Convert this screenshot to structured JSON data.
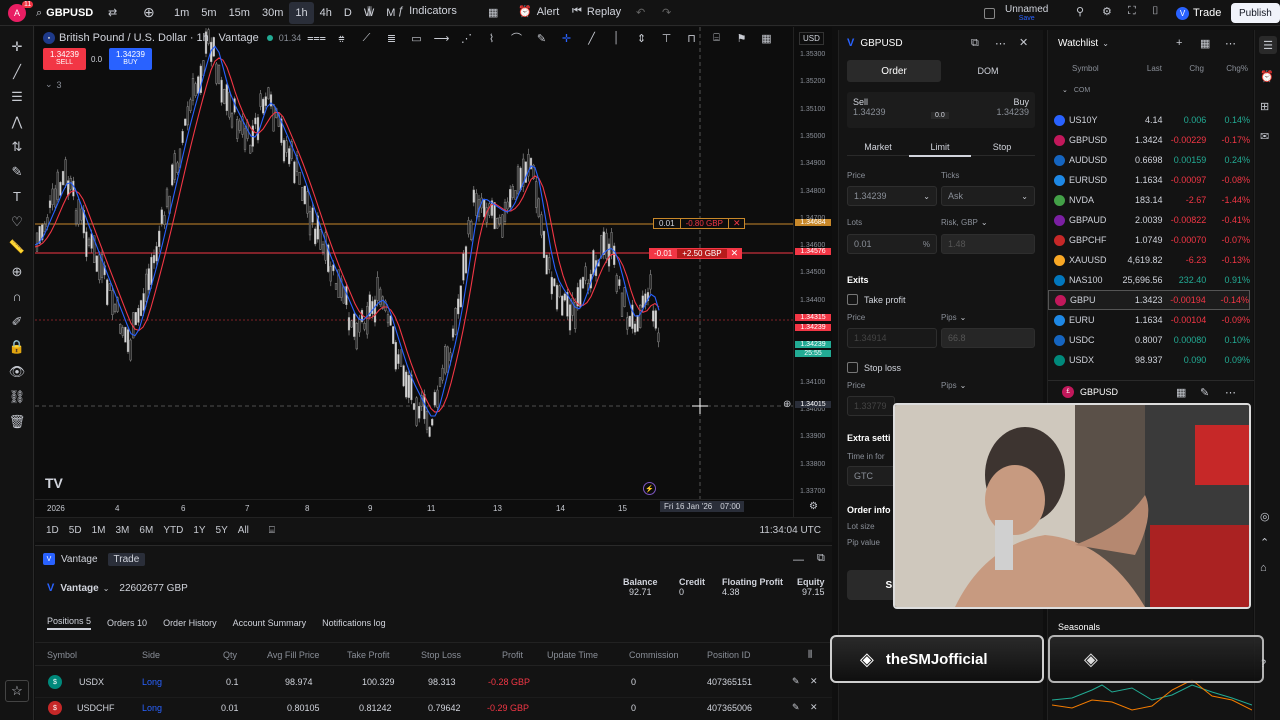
{
  "topbar": {
    "symbol": "GBPUSD",
    "timeframes": [
      "1m",
      "5m",
      "15m",
      "30m",
      "1h",
      "4h",
      "D",
      "W",
      "M"
    ],
    "active_timeframe": "1h",
    "indicators_label": "Indicators",
    "alert_label": "Alert",
    "replay_label": "Replay",
    "layout_name": "Unnamed",
    "layout_sub": "Save",
    "trade_label": "Trade",
    "publish_label": "Publish",
    "avatar_badge": "11"
  },
  "chart": {
    "legend_title": "British Pound / U.S. Dollar · 1h · Vantage",
    "legend_price": "01.34",
    "sell_price": "1.34239",
    "sell_label": "SELL",
    "spread": "0.0",
    "buy_price": "1.34239",
    "buy_label": "BUY",
    "indicator_count": "3",
    "currency": "USD",
    "order_line_1": {
      "qty": "0.01",
      "pnl": "-0.80 GBP"
    },
    "order_line_2": {
      "qty": "-0.01",
      "pnl": "+2.50 GBP"
    },
    "price_ticks": [
      "1.35300",
      "1.35200",
      "1.35100",
      "1.35000",
      "1.34900",
      "1.34800",
      "1.34700",
      "1.34600",
      "1.34500",
      "1.34400",
      "1.34300",
      "1.34200",
      "1.34100",
      "1.34000",
      "1.33900",
      "1.33800",
      "1.33700"
    ],
    "tag_upper": "1.34684",
    "tag_lower": "1.34576",
    "tag_price_a": "1.34315",
    "tag_price_b": "1.34239",
    "tag_price_c": "1.34239",
    "tag_time": "25:55",
    "crosshair_price": "1.34015",
    "date_ticks": [
      "2026",
      "4",
      "6",
      "7",
      "8",
      "9",
      "11",
      "13",
      "14",
      "15"
    ],
    "crosshair_date": "Fri 16 Jan '26",
    "crosshair_time": "07:00"
  },
  "rangebar": {
    "ranges": [
      "1D",
      "5D",
      "1M",
      "3M",
      "6M",
      "YTD",
      "1Y",
      "5Y",
      "All"
    ],
    "clock": "11:34:04 UTC"
  },
  "bottom": {
    "broker": "Vantage",
    "trade_tab": "Trade",
    "account": "22602677 GBP",
    "balance_label": "Balance",
    "balance": "92.71",
    "credit_label": "Credit",
    "credit": "0",
    "floating_label": "Floating Profit",
    "floating": "4.38",
    "equity_label": "Equity",
    "equity": "97.15",
    "tabs": [
      "Positions 5",
      "Orders 10",
      "Order History",
      "Account Summary",
      "Notifications log"
    ],
    "columns": [
      "Symbol",
      "Side",
      "Qty",
      "Avg Fill Price",
      "Take Profit",
      "Stop Loss",
      "Profit",
      "Update Time",
      "Commission",
      "Position ID"
    ],
    "rows": [
      {
        "symbol": "USDX",
        "side": "Long",
        "qty": "0.1",
        "avg": "98.974",
        "tp": "100.329",
        "sl": "98.313",
        "profit": "-0.28 GBP",
        "update": "",
        "commission": "0",
        "id": "407365151"
      },
      {
        "symbol": "USDCHF",
        "side": "Long",
        "qty": "0.01",
        "avg": "0.80105",
        "tp": "0.81242",
        "sl": "0.79642",
        "profit": "-0.29 GBP",
        "update": "",
        "commission": "0",
        "id": "407365006"
      }
    ]
  },
  "order": {
    "symbol": "GBPUSD",
    "tab_order": "Order",
    "tab_dom": "DOM",
    "sell_label": "Sell",
    "sell_price": "1.34239",
    "spread": "0.0",
    "buy_label": "Buy",
    "buy_price": "1.34239",
    "types": [
      "Market",
      "Limit",
      "Stop"
    ],
    "active_type": "Limit",
    "price_label": "Price",
    "price_value": "1.34239",
    "ticks_label": "Ticks",
    "ticks_value": "Ask",
    "lots_label": "Lots",
    "lots_value": "0.01",
    "risk_label": "Risk, GBP",
    "risk_value": "1.48",
    "exits_label": "Exits",
    "take_profit_label": "Take profit",
    "tp_price_label": "Price",
    "tp_price_value": "1.34914",
    "tp_pips_label": "Pips",
    "tp_pips_value": "66.8",
    "stop_loss_label": "Stop loss",
    "sl_price_label": "Price",
    "sl_price_value": "1.33779",
    "sl_pips_label": "Pips",
    "extra_label": "Extra setti",
    "time_in_force_label": "Time in for",
    "tif_value": "GTC",
    "order_info_label": "Order info",
    "lot_size_label": "Lot size",
    "pip_value_label": "Pip value",
    "submit_label": "Si"
  },
  "watchlist": {
    "title": "Watchlist",
    "headers": [
      "Symbol",
      "Last",
      "Chg",
      "Chg%"
    ],
    "group": "COM",
    "items": [
      {
        "symbol": "US10Y",
        "last": "4.14",
        "chg": "0.006",
        "pct": "0.14%",
        "up": true,
        "color": "#2962ff"
      },
      {
        "symbol": "GBPUSD",
        "last": "1.3424",
        "chg": "-0.00229",
        "pct": "-0.17%",
        "up": false,
        "color": "#c2185b"
      },
      {
        "symbol": "AUDUSD",
        "last": "0.6698",
        "chg": "0.00159",
        "pct": "0.24%",
        "up": true,
        "color": "#1565c0"
      },
      {
        "symbol": "EURUSD",
        "last": "1.1634",
        "chg": "-0.00097",
        "pct": "-0.08%",
        "up": false,
        "color": "#1e88e5"
      },
      {
        "symbol": "NVDA",
        "last": "183.14",
        "chg": "-2.67",
        "pct": "-1.44%",
        "up": false,
        "color": "#43a047"
      },
      {
        "symbol": "GBPAUD",
        "last": "2.0039",
        "chg": "-0.00822",
        "pct": "-0.41%",
        "up": false,
        "color": "#7b1fa2"
      },
      {
        "symbol": "GBPCHF",
        "last": "1.0749",
        "chg": "-0.00070",
        "pct": "-0.07%",
        "up": false,
        "color": "#c62828"
      },
      {
        "symbol": "XAUUSD",
        "last": "4,619.82",
        "chg": "-6.23",
        "pct": "-0.13%",
        "up": false,
        "color": "#f9a825"
      },
      {
        "symbol": "NAS100",
        "last": "25,696.56",
        "chg": "232.40",
        "pct": "0.91%",
        "up": true,
        "color": "#0277bd"
      },
      {
        "symbol": "GBPU",
        "last": "1.3423",
        "chg": "-0.00194",
        "pct": "-0.14%",
        "up": false,
        "color": "#c2185b"
      },
      {
        "symbol": "EURU",
        "last": "1.1634",
        "chg": "-0.00104",
        "pct": "-0.09%",
        "up": false,
        "color": "#1e88e5"
      },
      {
        "symbol": "USDC",
        "last": "0.8007",
        "chg": "0.00080",
        "pct": "0.10%",
        "up": true,
        "color": "#1565c0"
      },
      {
        "symbol": "USDX",
        "last": "98.937",
        "chg": "0.090",
        "pct": "0.09%",
        "up": true,
        "color": "#00897b"
      }
    ],
    "detail_symbol": "GBPUSD",
    "seasonals_label": "Seasonals"
  },
  "webcam": {
    "channel": "theSMJofficial"
  }
}
